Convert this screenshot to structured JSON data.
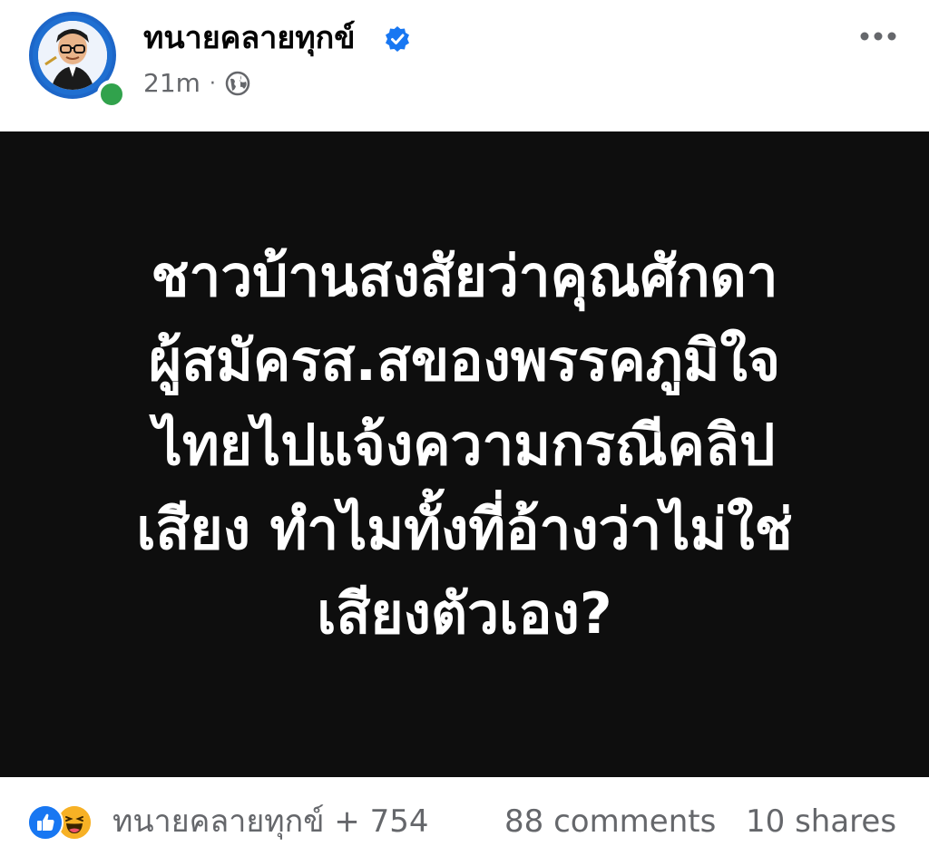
{
  "post": {
    "page_name": "ทนายคลายทุกข์",
    "time": "21m",
    "separator": "·",
    "verified_icon": "verified-badge-icon",
    "audience_icon": "globe-icon",
    "more_icon": "more-options-icon",
    "colors": {
      "verified": "#1877f2",
      "online": "#31a24c",
      "image_bg": "#0e0e0e",
      "meta_text": "#65676b"
    }
  },
  "image_text": {
    "lines": [
      "ชาวบ้านสงสัยว่าคุณศักดา",
      "ผู้สมัครส.สของพรรคภูมิใจ",
      "ไทยไปแจ้งความกรณีคลิป",
      "เสียง ทำไมทั้งที่อ้างว่าไม่ใช่",
      "เสียงตัวเอง?"
    ]
  },
  "footer": {
    "reaction_icons": [
      "like-icon",
      "haha-icon"
    ],
    "reaction_text": "ทนายคลายทุกข์ + 754",
    "comments": "88 comments",
    "shares": "10 shares"
  }
}
